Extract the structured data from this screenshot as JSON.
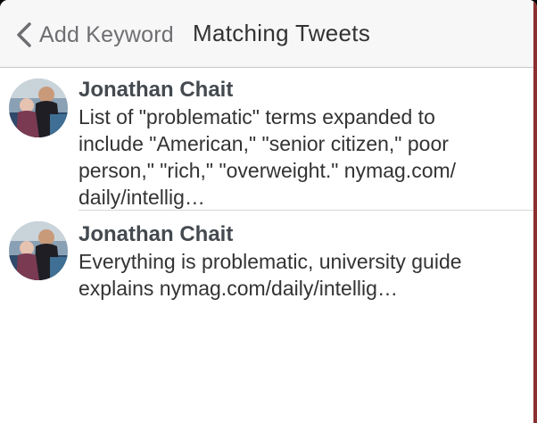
{
  "nav": {
    "back_label": "Add Keyword",
    "title": "Matching Tweets"
  },
  "tweets": [
    {
      "author": "Jonathan Chait",
      "text": "List of \"problematic\" terms expanded to\ninclude \"American,\" \"senior citizen,\" poor\nperson,\" \"rich,\" \"overweight.\" nymag.com/\ndaily/intellig…"
    },
    {
      "author": "Jonathan Chait",
      "text": "Everything is problematic, university guide\nexplains nymag.com/daily/intellig…"
    }
  ],
  "colors": {
    "nav_background": "#f7f7f7",
    "back_label": "#6e6e73",
    "title": "#333333",
    "author": "#444a50"
  },
  "icons": {
    "back": "chevron-left-icon",
    "avatar": "avatar-photo"
  }
}
